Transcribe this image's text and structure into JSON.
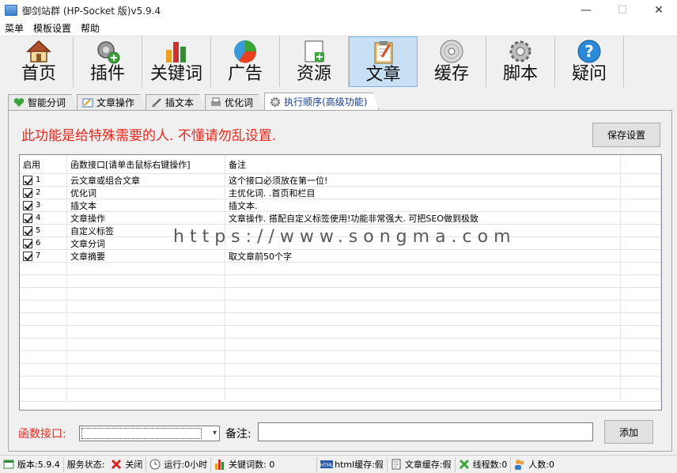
{
  "window": {
    "title": "御剑站群 (HP-Socket 版)v5.9.4",
    "minimize": "—",
    "maximize": "☐",
    "close": "✕"
  },
  "menu": [
    "菜单",
    "模板设置",
    "帮助"
  ],
  "toolbar": [
    {
      "label": "首页",
      "icon": "home-icon"
    },
    {
      "label": "插件",
      "icon": "plugin-icon"
    },
    {
      "label": "关键词",
      "icon": "bar-chart-icon"
    },
    {
      "label": "广告",
      "icon": "pie-chart-icon"
    },
    {
      "label": "资源",
      "icon": "resource-add-icon"
    },
    {
      "label": "文章",
      "icon": "clipboard-icon",
      "active": true
    },
    {
      "label": "缓存",
      "icon": "disc-icon"
    },
    {
      "label": "脚本",
      "icon": "gear-icon"
    },
    {
      "label": "疑问",
      "icon": "help-icon"
    }
  ],
  "tabs": [
    {
      "label": "智能分词",
      "icon": "heart-icon"
    },
    {
      "label": "文章操作",
      "icon": "edit-icon"
    },
    {
      "label": "插文本",
      "icon": "insert-icon"
    },
    {
      "label": "优化词",
      "icon": "printer-icon"
    },
    {
      "label": "执行顺序(高级功能)",
      "icon": "gear-icon",
      "active": true
    }
  ],
  "panel": {
    "warning": "此功能是给特殊需要的人. 不懂请勿乱设置.",
    "save_button": "保存设置"
  },
  "grid": {
    "headers": [
      "启用",
      "函数接口[请单击鼠标右键操作]",
      "备注",
      ""
    ],
    "rows": [
      {
        "num": "1",
        "func": "云文章或组合文章",
        "note": "这个接口必须放在第一位!",
        "checked": true
      },
      {
        "num": "2",
        "func": "优化词",
        "note": "主优化词. .首页和栏目",
        "checked": true
      },
      {
        "num": "3",
        "func": "插文本",
        "note": "插文本.",
        "checked": true
      },
      {
        "num": "4",
        "func": "文章操作",
        "note": "文章操作. 搭配自定义标签使用!功能非常强大. 可把SEO做到极致",
        "checked": true
      },
      {
        "num": "5",
        "func": "自定义标签",
        "note": "",
        "checked": true
      },
      {
        "num": "6",
        "func": "文章分词",
        "note": "",
        "checked": true
      },
      {
        "num": "7",
        "func": "文章摘要",
        "note": "取文章前50个字",
        "checked": true
      }
    ]
  },
  "watermark": "https://www.songma.com",
  "form": {
    "func_label": "函数接口:",
    "note_label": "备注:",
    "add_button": "添加"
  },
  "status": [
    {
      "text": "版本:5.9.4",
      "icon": "version-icon"
    },
    {
      "text": "服务状态:",
      "icon": ""
    },
    {
      "text": "关闭",
      "icon": "close-red-icon"
    },
    {
      "text": "运行:0小时",
      "icon": "clock-icon"
    },
    {
      "text": "关键词数: 0",
      "icon": "bar-chart-icon"
    },
    {
      "text": "html缓存:假",
      "icon": "html-icon"
    },
    {
      "text": "文章缓存:假",
      "icon": "document-icon"
    },
    {
      "text": "线程数:0",
      "icon": "thread-icon"
    },
    {
      "text": "人数:0",
      "icon": "users-icon"
    }
  ]
}
